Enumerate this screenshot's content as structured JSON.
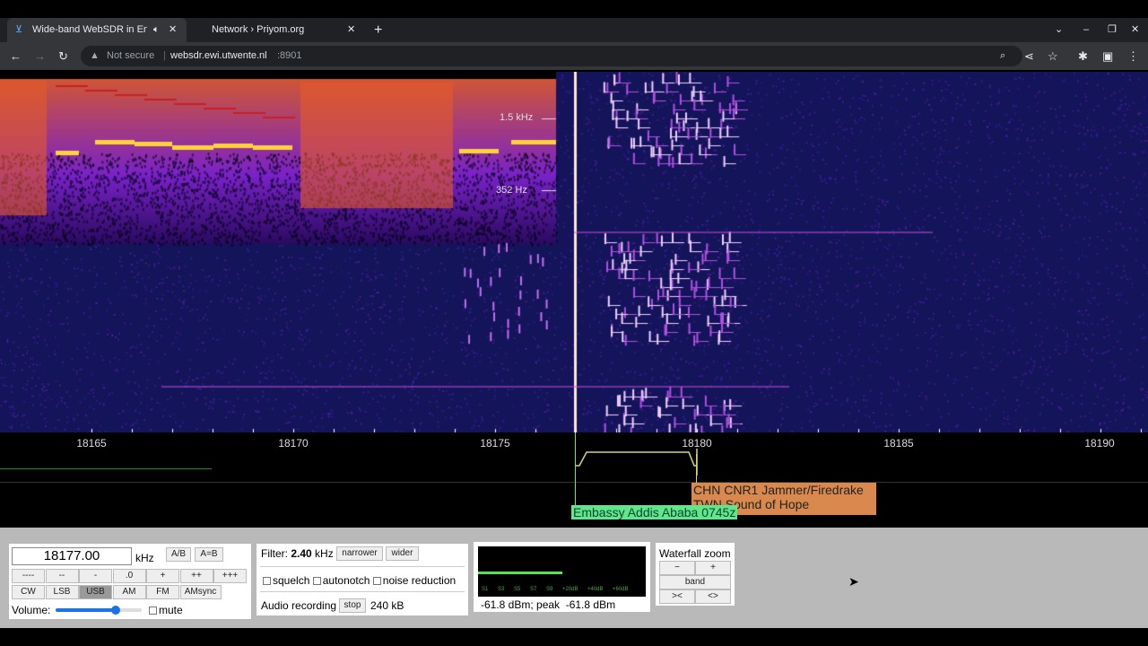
{
  "browser": {
    "tabs": [
      {
        "title": "Wide-band WebSDR in Ensch",
        "active": true,
        "audio": true
      },
      {
        "title": "Network › Priyom.org",
        "active": false
      }
    ],
    "security": "Not secure",
    "url_host": "websdr.ewi.utwente.nl",
    "url_port": ":8901"
  },
  "waterfall": {
    "audio_labels": [
      "1.5 kHz",
      "352 Hz"
    ],
    "freq_labels": [
      "18165",
      "18170",
      "18175",
      "18180",
      "18185",
      "18190"
    ],
    "station_labels": [
      "CHN CNR1 Jammer/Firedrake",
      "TWN Sound of Hope",
      "Embassy Addis Ababa 0745z"
    ],
    "colors": {
      "green_label": "#5fe88a",
      "orange_label": "#d9894d"
    }
  },
  "tuning": {
    "frequency": "18177.00",
    "unit": "kHz",
    "ab": "A/B",
    "aeqb": "A=B",
    "steps": [
      "----",
      "--",
      "-",
      ".0",
      "+",
      "++",
      "+++"
    ],
    "modes": [
      "CW",
      "LSB",
      "USB",
      "AM",
      "FM",
      "AMsync"
    ],
    "selected_mode": "USB",
    "volume_label": "Volume:",
    "volume": 0.7,
    "mute": "mute"
  },
  "filter": {
    "label": "Filter:",
    "value": "2.40",
    "unit": "kHz",
    "narrower": "narrower",
    "wider": "wider",
    "squelch": "squelch",
    "autonotch": "autonotch",
    "noise_reduction": "noise reduction",
    "recording_label": "Audio recording",
    "stop": "stop",
    "size": "240 kB"
  },
  "smeter": {
    "ticks": [
      "S1",
      "S3",
      "S5",
      "S7",
      "S9",
      "+20dB",
      "+40dB",
      "+60dB"
    ],
    "reading": "-61.8 dBm; peak  -61.8 dBm"
  },
  "wfzoom": {
    "title": "Waterfall zoom",
    "minus": "−",
    "plus": "+",
    "band": "band",
    "narrow": "><",
    "wide": "<>"
  }
}
